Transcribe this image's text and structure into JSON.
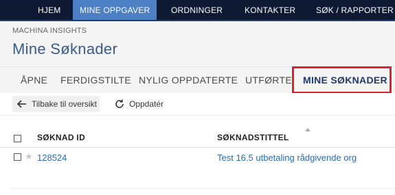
{
  "topnav": {
    "items": [
      {
        "label": "HJEM"
      },
      {
        "label": "MINE OPPGAVER",
        "active": true
      },
      {
        "label": "ORDNINGER"
      },
      {
        "label": "KONTAKTER"
      },
      {
        "label": "SØK / RAPPORTER"
      }
    ]
  },
  "header": {
    "app_name": "MACHINA INSIGHTS",
    "title": "Mine Søknader"
  },
  "tabs": [
    {
      "label": "ÅPNE"
    },
    {
      "label": "FERDIGSTILTE"
    },
    {
      "label": "NYLIG OPPDATERTE"
    },
    {
      "label": "UTFØRTE"
    },
    {
      "label": "MINE SØKNADER",
      "active": true
    }
  ],
  "toolbar": {
    "back_label": "Tilbake til oversikt",
    "refresh_label": "Oppdatér"
  },
  "table": {
    "columns": [
      "SØKNAD ID",
      "SØKNADSTITTEL"
    ],
    "rows": [
      {
        "id": "128524",
        "title": "Test 16.5 utbetaling rådgivende org"
      }
    ]
  },
  "colors": {
    "topbar": "#0e1a33",
    "active_nav": "#4c7fc3",
    "title": "#3a5a8c",
    "link": "#2a6cb0",
    "highlight": "#d9232f"
  }
}
